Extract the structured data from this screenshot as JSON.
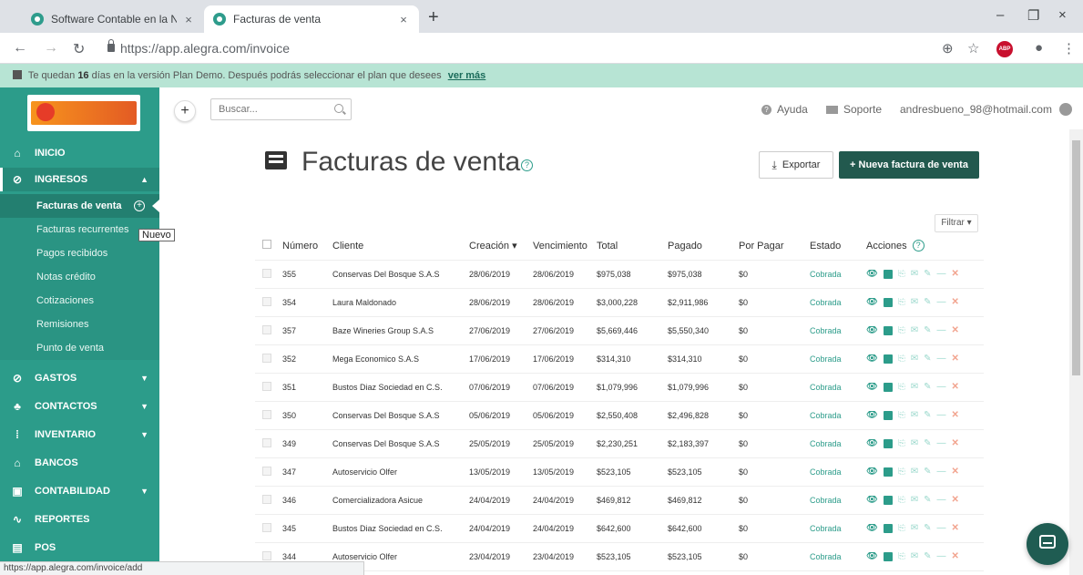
{
  "browser": {
    "tabs": [
      {
        "label": "Software Contable en la Nube pa",
        "close": "×"
      },
      {
        "label": "Facturas de venta",
        "close": "×"
      }
    ],
    "new_tab": "+",
    "window_controls": {
      "minimize": "–",
      "maximize": "❐",
      "close": "×"
    },
    "url": "https://app.alegra.com/invoice",
    "status_url": "https://app.alegra.com/invoice/add",
    "abp_label": "ABP"
  },
  "banner": {
    "prefix": "Te quedan",
    "days": "16",
    "suffix": "días en la versión Plan Demo. Después podrás seleccionar el plan que desees",
    "link": "ver más"
  },
  "sidebar": {
    "items": [
      {
        "label": "INICIO",
        "icon": "home-icon"
      },
      {
        "label": "INGRESOS",
        "icon": "ingresos-icon",
        "open": true
      },
      {
        "label": "GASTOS",
        "icon": "gastos-icon"
      },
      {
        "label": "CONTACTOS",
        "icon": "contacts-icon"
      },
      {
        "label": "INVENTARIO",
        "icon": "inventory-icon"
      },
      {
        "label": "BANCOS",
        "icon": "bank-icon"
      },
      {
        "label": "CONTABILIDAD",
        "icon": "accounting-icon"
      },
      {
        "label": "REPORTES",
        "icon": "reports-icon"
      },
      {
        "label": "POS",
        "icon": "pos-icon"
      }
    ],
    "sub_items": [
      "Facturas de venta",
      "Facturas recurrentes",
      "Pagos recibidos",
      "Notas crédito",
      "Cotizaciones",
      "Remisiones",
      "Punto de venta"
    ],
    "tooltip": "Nuevo"
  },
  "topbar": {
    "search_placeholder": "Buscar...",
    "help": "Ayuda",
    "support": "Soporte",
    "user_email": "andresbueno_98@hotmail.com"
  },
  "page": {
    "title": "Facturas de venta",
    "export_label": "Exportar",
    "new_label": "+ Nueva factura de venta",
    "filter_label": "Filtrar ▾"
  },
  "table": {
    "headers": {
      "numero": "Número",
      "cliente": "Cliente",
      "creacion": "Creación ▾",
      "vencimiento": "Vencimiento",
      "total": "Total",
      "pagado": "Pagado",
      "por_pagar": "Por Pagar",
      "estado": "Estado",
      "acciones": "Acciones"
    },
    "rows": [
      {
        "numero": "355",
        "cliente": "Conservas Del Bosque S.A.S",
        "creacion": "28/06/2019",
        "vencimiento": "28/06/2019",
        "total": "$975,038",
        "pagado": "$975,038",
        "por_pagar": "$0",
        "estado": "Cobrada"
      },
      {
        "numero": "354",
        "cliente": "Laura Maldonado",
        "creacion": "28/06/2019",
        "vencimiento": "28/06/2019",
        "total": "$3,000,228",
        "pagado": "$2,911,986",
        "por_pagar": "$0",
        "estado": "Cobrada"
      },
      {
        "numero": "357",
        "cliente": "Baze Wineries Group S.A.S",
        "creacion": "27/06/2019",
        "vencimiento": "27/06/2019",
        "total": "$5,669,446",
        "pagado": "$5,550,340",
        "por_pagar": "$0",
        "estado": "Cobrada"
      },
      {
        "numero": "352",
        "cliente": "Mega Economico S.A.S",
        "creacion": "17/06/2019",
        "vencimiento": "17/06/2019",
        "total": "$314,310",
        "pagado": "$314,310",
        "por_pagar": "$0",
        "estado": "Cobrada"
      },
      {
        "numero": "351",
        "cliente": "Bustos Diaz Sociedad en C.S.",
        "creacion": "07/06/2019",
        "vencimiento": "07/06/2019",
        "total": "$1,079,996",
        "pagado": "$1,079,996",
        "por_pagar": "$0",
        "estado": "Cobrada"
      },
      {
        "numero": "350",
        "cliente": "Conservas Del Bosque S.A.S",
        "creacion": "05/06/2019",
        "vencimiento": "05/06/2019",
        "total": "$2,550,408",
        "pagado": "$2,496,828",
        "por_pagar": "$0",
        "estado": "Cobrada"
      },
      {
        "numero": "349",
        "cliente": "Conservas Del Bosque S.A.S",
        "creacion": "25/05/2019",
        "vencimiento": "25/05/2019",
        "total": "$2,230,251",
        "pagado": "$2,183,397",
        "por_pagar": "$0",
        "estado": "Cobrada"
      },
      {
        "numero": "347",
        "cliente": "Autoservicio Olfer",
        "creacion": "13/05/2019",
        "vencimiento": "13/05/2019",
        "total": "$523,105",
        "pagado": "$523,105",
        "por_pagar": "$0",
        "estado": "Cobrada"
      },
      {
        "numero": "346",
        "cliente": "Comercializadora Asicue",
        "creacion": "24/04/2019",
        "vencimiento": "24/04/2019",
        "total": "$469,812",
        "pagado": "$469,812",
        "por_pagar": "$0",
        "estado": "Cobrada"
      },
      {
        "numero": "345",
        "cliente": "Bustos Diaz Sociedad en C.S.",
        "creacion": "24/04/2019",
        "vencimiento": "24/04/2019",
        "total": "$642,600",
        "pagado": "$642,600",
        "por_pagar": "$0",
        "estado": "Cobrada"
      },
      {
        "numero": "344",
        "cliente": "Autoservicio Olfer",
        "creacion": "23/04/2019",
        "vencimiento": "23/04/2019",
        "total": "$523,105",
        "pagado": "$523,105",
        "por_pagar": "$0",
        "estado": "Cobrada"
      }
    ]
  },
  "colors": {
    "accent": "#2c9c8a",
    "dark_button": "#22594e",
    "banner": "#b7e4d4",
    "delete": "#f2a48f"
  }
}
